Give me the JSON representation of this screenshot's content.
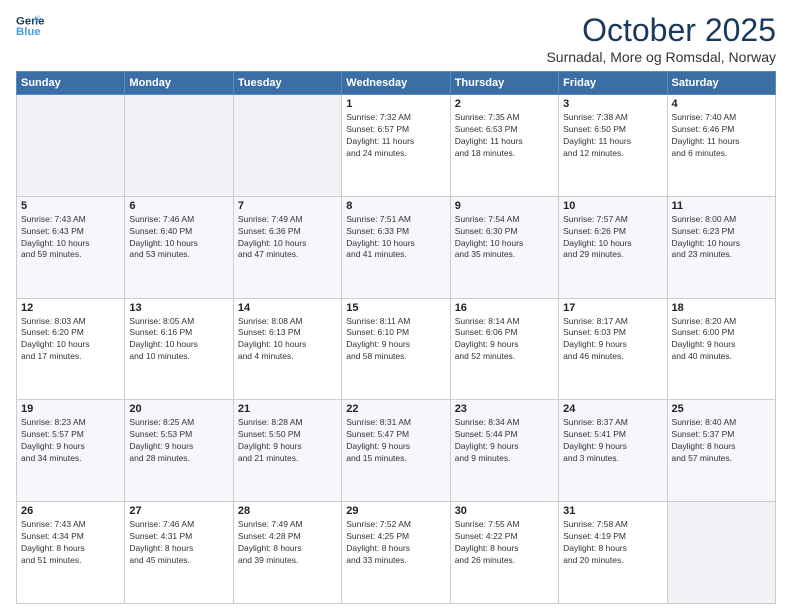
{
  "logo": {
    "line1": "General",
    "line2": "Blue"
  },
  "title": "October 2025",
  "location": "Surnadal, More og Romsdal, Norway",
  "weekdays": [
    "Sunday",
    "Monday",
    "Tuesday",
    "Wednesday",
    "Thursday",
    "Friday",
    "Saturday"
  ],
  "weeks": [
    [
      {
        "day": "",
        "info": ""
      },
      {
        "day": "",
        "info": ""
      },
      {
        "day": "",
        "info": ""
      },
      {
        "day": "1",
        "info": "Sunrise: 7:32 AM\nSunset: 6:57 PM\nDaylight: 11 hours\nand 24 minutes."
      },
      {
        "day": "2",
        "info": "Sunrise: 7:35 AM\nSunset: 6:53 PM\nDaylight: 11 hours\nand 18 minutes."
      },
      {
        "day": "3",
        "info": "Sunrise: 7:38 AM\nSunset: 6:50 PM\nDaylight: 11 hours\nand 12 minutes."
      },
      {
        "day": "4",
        "info": "Sunrise: 7:40 AM\nSunset: 6:46 PM\nDaylight: 11 hours\nand 6 minutes."
      }
    ],
    [
      {
        "day": "5",
        "info": "Sunrise: 7:43 AM\nSunset: 6:43 PM\nDaylight: 10 hours\nand 59 minutes."
      },
      {
        "day": "6",
        "info": "Sunrise: 7:46 AM\nSunset: 6:40 PM\nDaylight: 10 hours\nand 53 minutes."
      },
      {
        "day": "7",
        "info": "Sunrise: 7:49 AM\nSunset: 6:36 PM\nDaylight: 10 hours\nand 47 minutes."
      },
      {
        "day": "8",
        "info": "Sunrise: 7:51 AM\nSunset: 6:33 PM\nDaylight: 10 hours\nand 41 minutes."
      },
      {
        "day": "9",
        "info": "Sunrise: 7:54 AM\nSunset: 6:30 PM\nDaylight: 10 hours\nand 35 minutes."
      },
      {
        "day": "10",
        "info": "Sunrise: 7:57 AM\nSunset: 6:26 PM\nDaylight: 10 hours\nand 29 minutes."
      },
      {
        "day": "11",
        "info": "Sunrise: 8:00 AM\nSunset: 6:23 PM\nDaylight: 10 hours\nand 23 minutes."
      }
    ],
    [
      {
        "day": "12",
        "info": "Sunrise: 8:03 AM\nSunset: 6:20 PM\nDaylight: 10 hours\nand 17 minutes."
      },
      {
        "day": "13",
        "info": "Sunrise: 8:05 AM\nSunset: 6:16 PM\nDaylight: 10 hours\nand 10 minutes."
      },
      {
        "day": "14",
        "info": "Sunrise: 8:08 AM\nSunset: 6:13 PM\nDaylight: 10 hours\nand 4 minutes."
      },
      {
        "day": "15",
        "info": "Sunrise: 8:11 AM\nSunset: 6:10 PM\nDaylight: 9 hours\nand 58 minutes."
      },
      {
        "day": "16",
        "info": "Sunrise: 8:14 AM\nSunset: 6:06 PM\nDaylight: 9 hours\nand 52 minutes."
      },
      {
        "day": "17",
        "info": "Sunrise: 8:17 AM\nSunset: 6:03 PM\nDaylight: 9 hours\nand 46 minutes."
      },
      {
        "day": "18",
        "info": "Sunrise: 8:20 AM\nSunset: 6:00 PM\nDaylight: 9 hours\nand 40 minutes."
      }
    ],
    [
      {
        "day": "19",
        "info": "Sunrise: 8:23 AM\nSunset: 5:57 PM\nDaylight: 9 hours\nand 34 minutes."
      },
      {
        "day": "20",
        "info": "Sunrise: 8:25 AM\nSunset: 5:53 PM\nDaylight: 9 hours\nand 28 minutes."
      },
      {
        "day": "21",
        "info": "Sunrise: 8:28 AM\nSunset: 5:50 PM\nDaylight: 9 hours\nand 21 minutes."
      },
      {
        "day": "22",
        "info": "Sunrise: 8:31 AM\nSunset: 5:47 PM\nDaylight: 9 hours\nand 15 minutes."
      },
      {
        "day": "23",
        "info": "Sunrise: 8:34 AM\nSunset: 5:44 PM\nDaylight: 9 hours\nand 9 minutes."
      },
      {
        "day": "24",
        "info": "Sunrise: 8:37 AM\nSunset: 5:41 PM\nDaylight: 9 hours\nand 3 minutes."
      },
      {
        "day": "25",
        "info": "Sunrise: 8:40 AM\nSunset: 5:37 PM\nDaylight: 8 hours\nand 57 minutes."
      }
    ],
    [
      {
        "day": "26",
        "info": "Sunrise: 7:43 AM\nSunset: 4:34 PM\nDaylight: 8 hours\nand 51 minutes."
      },
      {
        "day": "27",
        "info": "Sunrise: 7:46 AM\nSunset: 4:31 PM\nDaylight: 8 hours\nand 45 minutes."
      },
      {
        "day": "28",
        "info": "Sunrise: 7:49 AM\nSunset: 4:28 PM\nDaylight: 8 hours\nand 39 minutes."
      },
      {
        "day": "29",
        "info": "Sunrise: 7:52 AM\nSunset: 4:25 PM\nDaylight: 8 hours\nand 33 minutes."
      },
      {
        "day": "30",
        "info": "Sunrise: 7:55 AM\nSunset: 4:22 PM\nDaylight: 8 hours\nand 26 minutes."
      },
      {
        "day": "31",
        "info": "Sunrise: 7:58 AM\nSunset: 4:19 PM\nDaylight: 8 hours\nand 20 minutes."
      },
      {
        "day": "",
        "info": ""
      }
    ]
  ]
}
